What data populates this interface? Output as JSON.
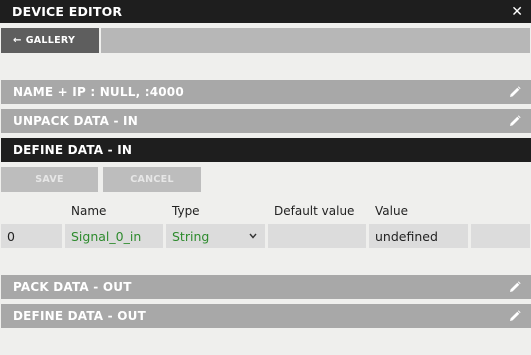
{
  "window": {
    "title": "DEVICE EDITOR",
    "close_glyph": "✕"
  },
  "nav": {
    "back_arrow": "←",
    "gallery_label": "GALLERY"
  },
  "sections": {
    "name_ip": "NAME + IP : NULL, :4000",
    "unpack_in": "UNPACK DATA - IN",
    "define_in": "DEFINE DATA - IN",
    "pack_out": "PACK DATA - OUT",
    "define_out": "DEFINE DATA - OUT"
  },
  "define_in": {
    "save_label": "SAVE",
    "cancel_label": "CANCEL",
    "columns": {
      "name": "Name",
      "type": "Type",
      "default_value": "Default value",
      "value": "Value"
    },
    "rows": [
      {
        "index": "0",
        "name": "Signal_0_in",
        "type": "String",
        "default_value": "",
        "value": "undefined"
      }
    ]
  },
  "colors": {
    "titlebar": "#1e1e1e",
    "section_collapsed": "#a8a8a8",
    "section_active": "#1e1e1e",
    "button_disabled": "#bdbdbd",
    "cell_bg": "#dcdcdc",
    "accent_green": "#2e8b2e"
  },
  "icons": {
    "close": "close-icon",
    "back": "arrow-left-icon",
    "edit": "pencil-icon",
    "dropdown": "chevron-down-icon"
  }
}
